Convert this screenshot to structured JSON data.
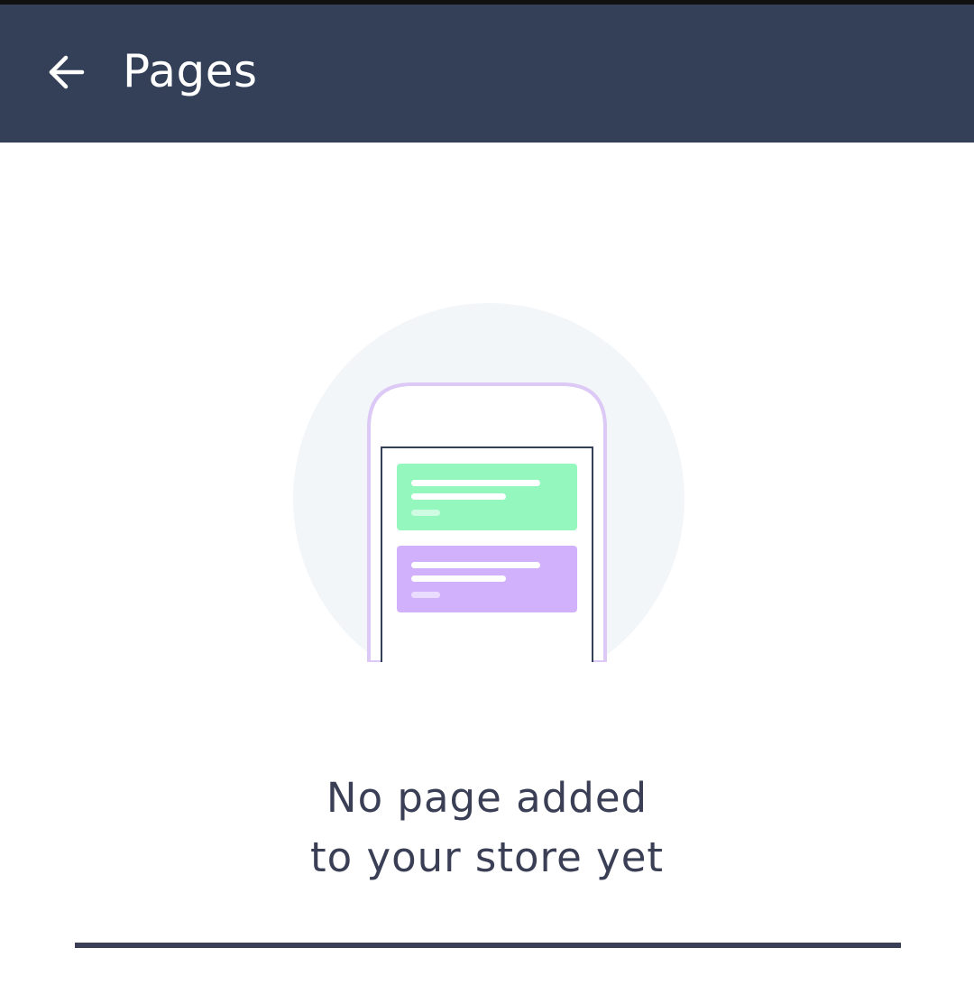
{
  "app_bar": {
    "title": "Pages",
    "back_icon": "arrow-left-icon",
    "background": "#334058"
  },
  "illustration": {
    "icon": "phone-with-page-cards-illustration",
    "circle_color": "#f3f6f9",
    "phone_outline_color": "#dcc9f5",
    "card_colors": [
      "#94f7be",
      "#d1b1fc"
    ]
  },
  "empty_state": {
    "line1": "No page added",
    "line2": "to your store yet",
    "text_color": "#3a3f55"
  }
}
